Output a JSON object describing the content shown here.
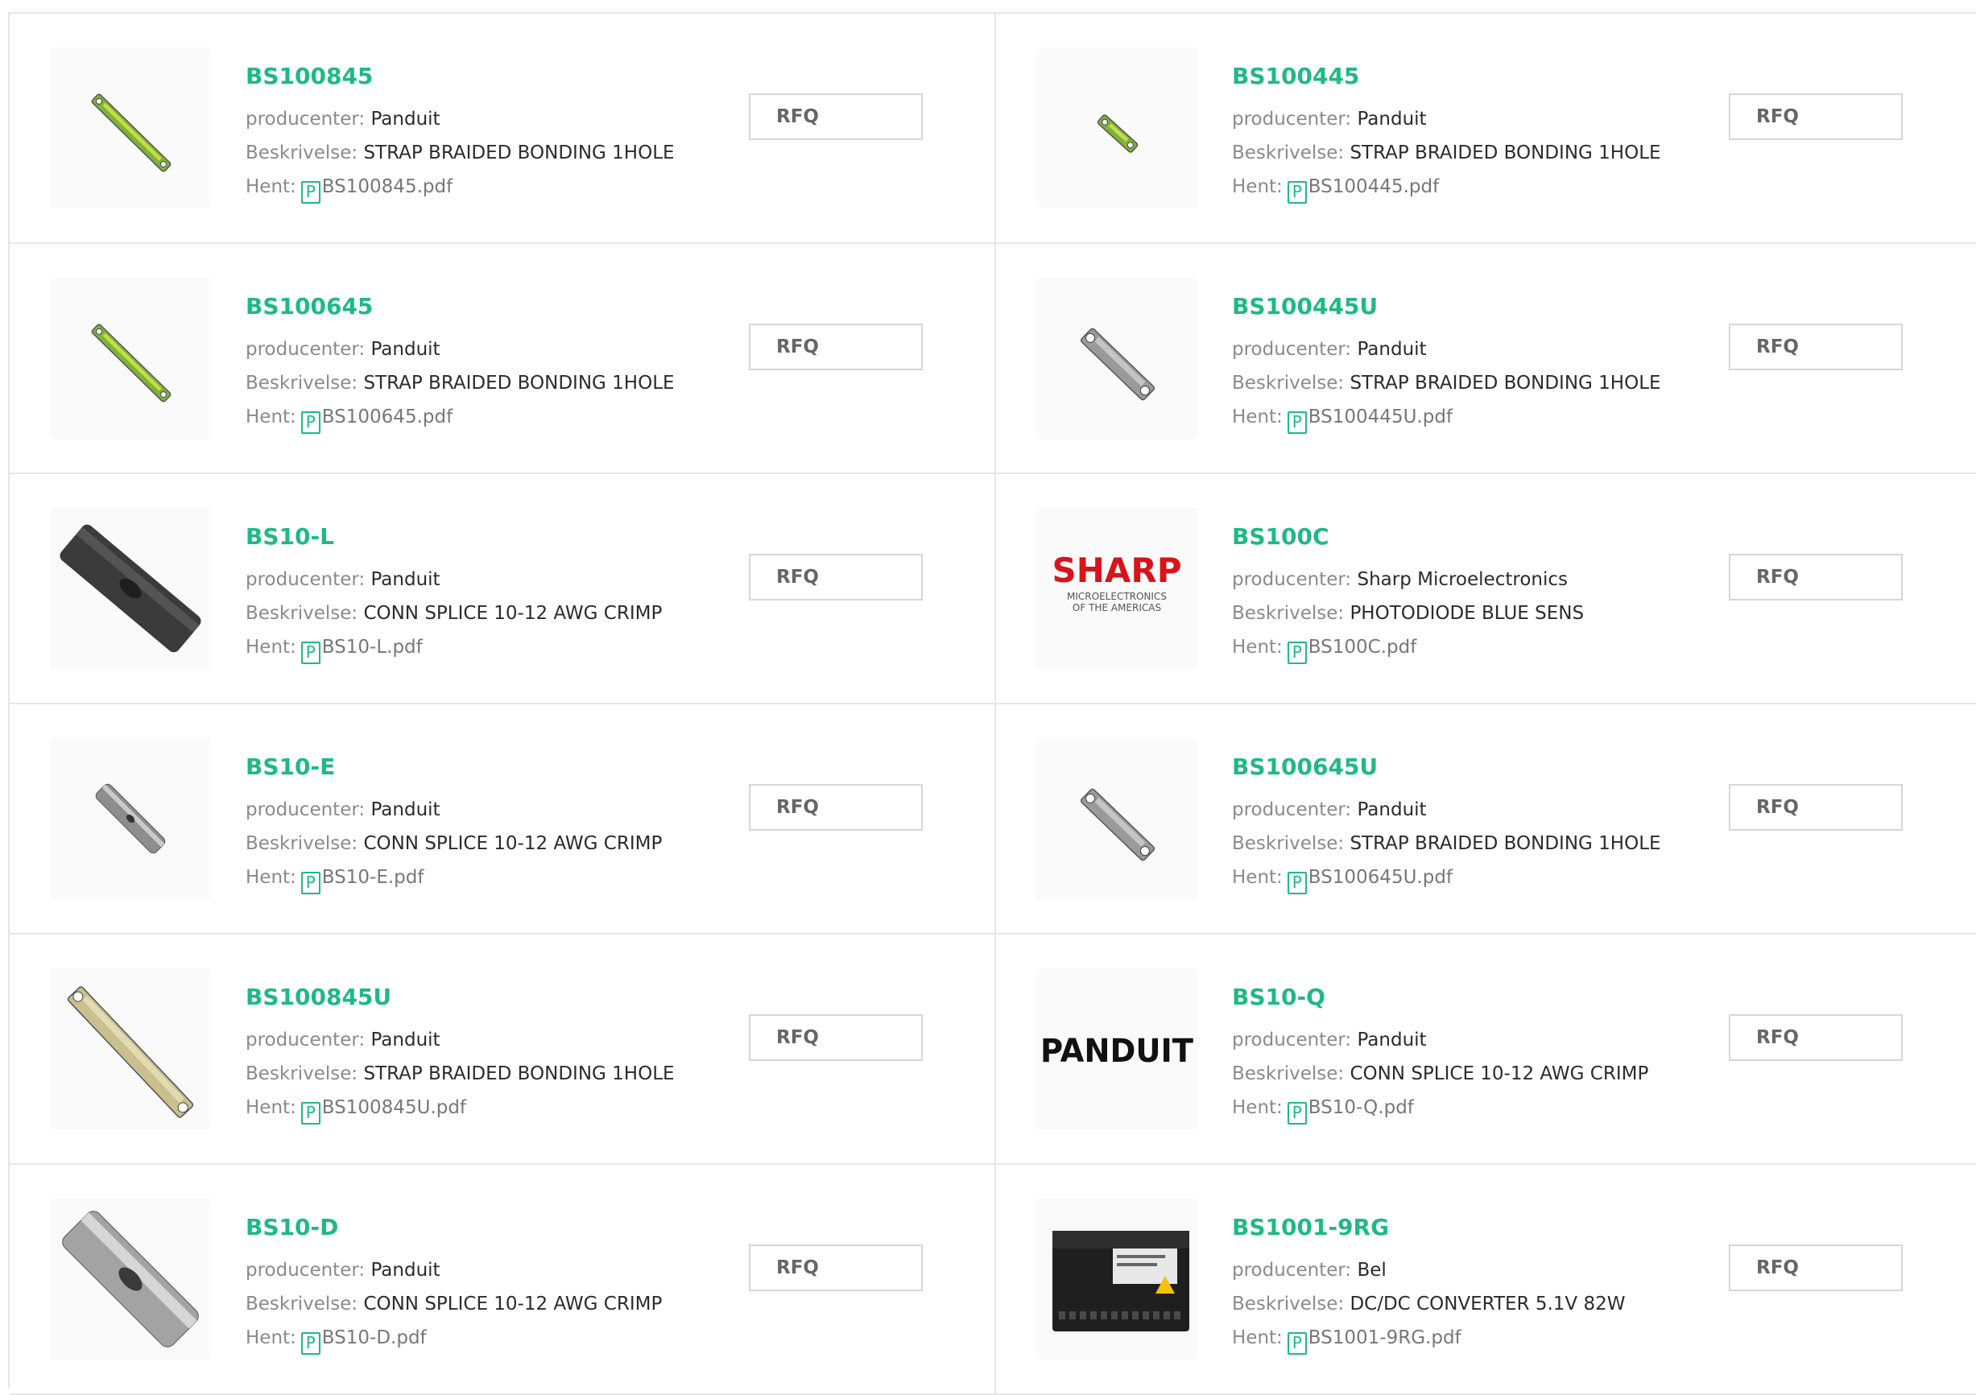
{
  "labels": {
    "manufacturer": "producenter:",
    "description": "Beskrivelse:",
    "download": "Hent:",
    "rfq": "RFQ",
    "pdf_glyph": "P"
  },
  "colors": {
    "accent": "#1fb986",
    "border": "#e6e6e6"
  },
  "products": [
    {
      "pn": "BS100845",
      "manufacturer": "Panduit",
      "description": "STRAP BRAIDED BONDING 1HOLE",
      "file": "BS100845.pdf",
      "image": "green-strap-image"
    },
    {
      "pn": "BS100445",
      "manufacturer": "Panduit",
      "description": "STRAP BRAIDED BONDING 1HOLE",
      "file": "BS100445.pdf",
      "image": "green-strap-small-image"
    },
    {
      "pn": "BS100645",
      "manufacturer": "Panduit",
      "description": "STRAP BRAIDED BONDING 1HOLE",
      "file": "BS100645.pdf",
      "image": "green-strap-image"
    },
    {
      "pn": "BS100445U",
      "manufacturer": "Panduit",
      "description": "STRAP BRAIDED BONDING 1HOLE",
      "file": "BS100445U.pdf",
      "image": "metal-strap-image"
    },
    {
      "pn": "BS10-L",
      "manufacturer": "Panduit",
      "description": "CONN SPLICE 10-12 AWG CRIMP",
      "file": "BS10-L.pdf",
      "image": "dark-splice-image"
    },
    {
      "pn": "BS100C",
      "manufacturer": "Sharp Microelectronics",
      "description": "PHOTODIODE BLUE SENS",
      "file": "BS100C.pdf",
      "image": "sharp-logo"
    },
    {
      "pn": "BS10-E",
      "manufacturer": "Panduit",
      "description": "CONN SPLICE 10-12 AWG CRIMP",
      "file": "BS10-E.pdf",
      "image": "small-splice-image"
    },
    {
      "pn": "BS100645U",
      "manufacturer": "Panduit",
      "description": "STRAP BRAIDED BONDING 1HOLE",
      "file": "BS100645U.pdf",
      "image": "metal-strap-image"
    },
    {
      "pn": "BS100845U",
      "manufacturer": "Panduit",
      "description": "STRAP BRAIDED BONDING 1HOLE",
      "file": "BS100845U.pdf",
      "image": "tan-strap-image"
    },
    {
      "pn": "BS10-Q",
      "manufacturer": "Panduit",
      "description": "CONN SPLICE 10-12 AWG CRIMP",
      "file": "BS10-Q.pdf",
      "image": "panduit-logo"
    },
    {
      "pn": "BS10-D",
      "manufacturer": "Panduit",
      "description": "CONN SPLICE 10-12 AWG CRIMP",
      "file": "BS10-D.pdf",
      "image": "silver-splice-image"
    },
    {
      "pn": "BS1001-9RG",
      "manufacturer": "Bel",
      "description": "DC/DC CONVERTER 5.1V 82W",
      "file": "BS1001-9RG.pdf",
      "image": "converter-image"
    }
  ],
  "logos": {
    "sharp_word": "SHARP",
    "sharp_line1": "MICROELECTRONICS",
    "sharp_line2": "OF THE AMERICAS",
    "panduit_word": "PANDUIT"
  }
}
